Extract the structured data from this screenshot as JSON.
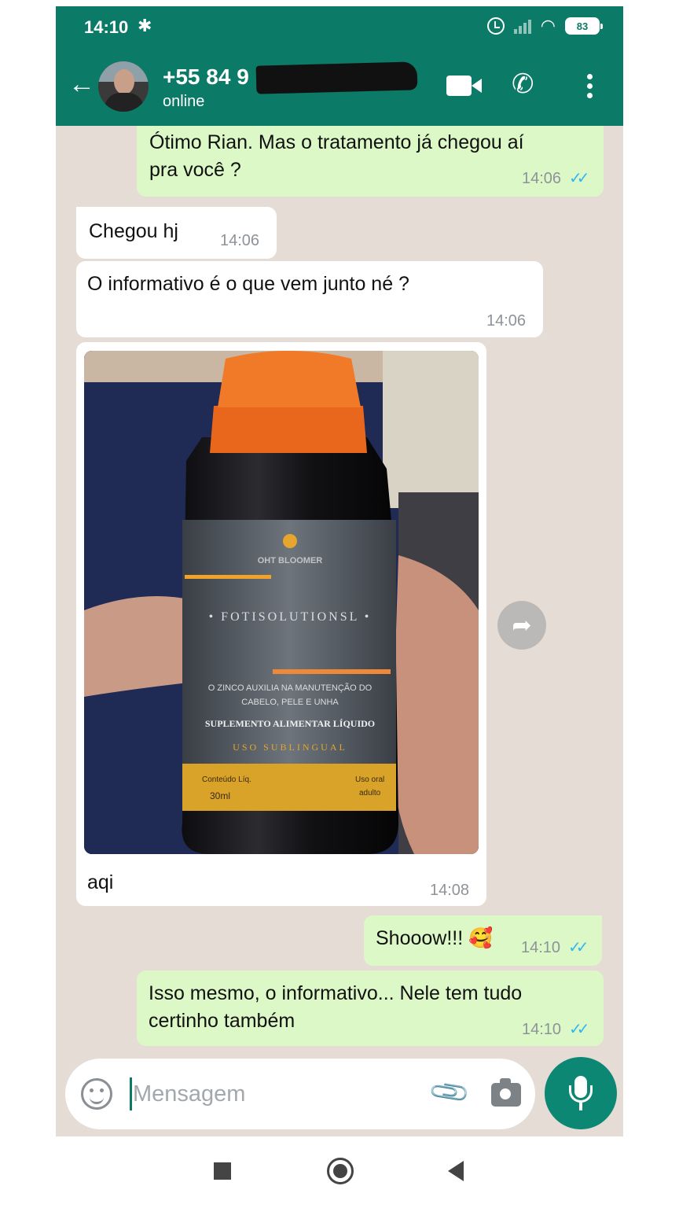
{
  "status_bar": {
    "time": "14:10",
    "bluetooth_icon": "bluetooth-icon",
    "battery": "83"
  },
  "header": {
    "contact_name": "+55 84 9",
    "contact_status": "online",
    "accent_color": "#0b7a66"
  },
  "messages": [
    {
      "direction": "out",
      "text_line1": "Ótimo Rian. Mas o tratamento já chegou aí",
      "text_line2": "pra você ?",
      "time": "14:06",
      "ticks": "✓✓"
    },
    {
      "direction": "in",
      "text": "Chegou hj",
      "time": "14:06"
    },
    {
      "direction": "in",
      "text": "O informativo é o que vem junto né ?",
      "time": "14:06"
    },
    {
      "direction": "in",
      "type": "image",
      "caption": "aqi",
      "time": "14:08"
    },
    {
      "direction": "out",
      "text": "Shooow!!! 🥰",
      "time": "14:10",
      "ticks": "✓✓"
    },
    {
      "direction": "out",
      "text_line1": "Isso mesmo, o informativo... Nele tem tudo",
      "text_line2": "certinho também",
      "time": "14:10",
      "ticks": "✓✓"
    }
  ],
  "photo": {
    "brand": "OHT BLOOMER",
    "product": "• FOTISOLUTIONSL •",
    "desc_line1": "O ZINCO AUXILIA NA MANUTENÇÃO DO",
    "desc_line2": "CABELO, PELE E UNHA",
    "supplement": "SUPLEMENTO ALIMENTAR LÍQUIDO",
    "usage": "USO SUBLINGUAL",
    "content_label": "Conteúdo Líq.",
    "content_value": "30ml",
    "use_label": "Uso oral",
    "use_value": "adulto"
  },
  "composer": {
    "placeholder": "Mensagem"
  }
}
